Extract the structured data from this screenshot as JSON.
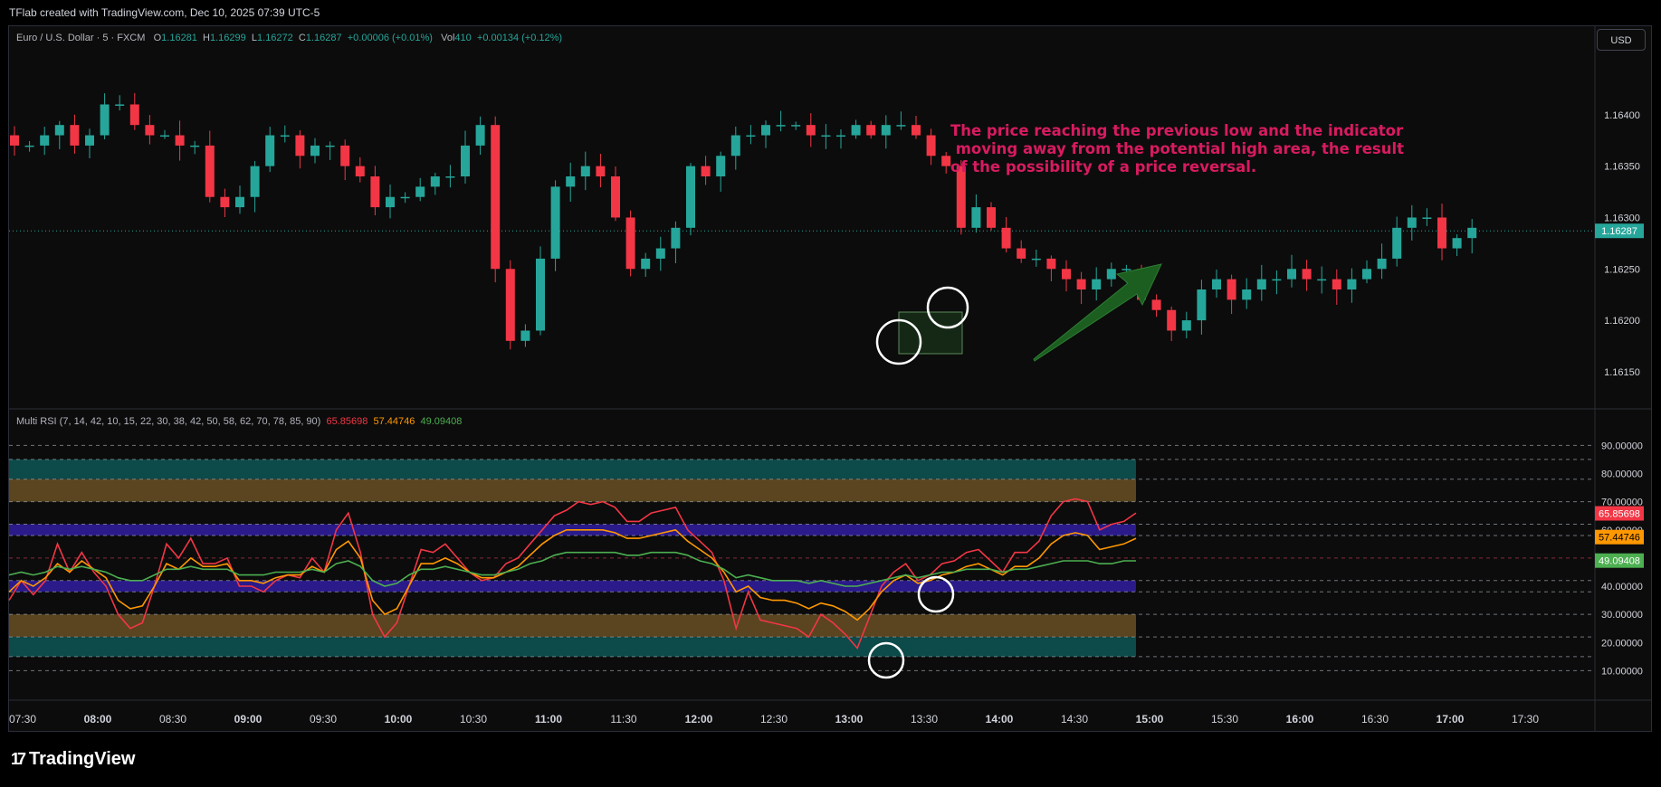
{
  "header": {
    "attribution": "TFlab created with TradingView.com, Dec 10, 2025 07:39 UTC-5"
  },
  "legend": {
    "symbol": "Euro / U.S. Dollar · 5 · FXCM",
    "open_label": "O",
    "open": "1.16281",
    "high_label": "H",
    "high": "1.16299",
    "low_label": "L",
    "low": "1.16272",
    "close_label": "C",
    "close": "1.16287",
    "change": "+0.00006 (+0.01%)",
    "vol_label": "Vol",
    "vol": "410",
    "vol_change": "+0.00134 (+0.12%)"
  },
  "currency_button": "USD",
  "annotation": "The price reaching the previous low and the indicator\n moving away from the potential high area, the result\nof the possibility of a price reversal.",
  "rsi_legend": {
    "name": "Multi RSI (7, 14, 42, 10, 15, 22, 30, 38, 42, 50, 58, 62, 70, 78, 85, 90)",
    "v1": "65.85698",
    "v2": "57.44746",
    "v3": "49.09408"
  },
  "brand": {
    "name": "TradingView"
  },
  "colors": {
    "up": "#26a69a",
    "down": "#f23645",
    "rsi_fast": "#f23645",
    "rsi_mid": "#ff9800",
    "rsi_slow": "#4caf50",
    "annotation": "#d81b60",
    "arrow": "#1b5e20"
  },
  "chart_data": [
    {
      "type": "candlestick",
      "title": "Euro / U.S. Dollar · 5 · FXCM",
      "ylim": [
        1.1612,
        1.1645
      ],
      "yticks": [
        "1.16400",
        "1.16350",
        "1.16300",
        "1.16250",
        "1.16200",
        "1.16150"
      ],
      "last_price": "1.16287",
      "xticks": [
        "07:30",
        "08:00",
        "08:30",
        "09:00",
        "09:30",
        "10:00",
        "10:30",
        "11:00",
        "11:30",
        "12:00",
        "12:30",
        "13:00",
        "13:30",
        "14:00",
        "14:30",
        "15:00",
        "15:30",
        "16:00",
        "16:30",
        "17:00",
        "17:30"
      ],
      "close": [
        1.1637,
        1.1637,
        1.1638,
        1.1639,
        1.1637,
        1.1638,
        1.1641,
        1.1641,
        1.1639,
        1.1638,
        1.1638,
        1.1637,
        1.1637,
        1.1632,
        1.1631,
        1.1632,
        1.1635,
        1.1638,
        1.1638,
        1.1636,
        1.1637,
        1.1637,
        1.1635,
        1.1634,
        1.1631,
        1.1632,
        1.1632,
        1.1633,
        1.1634,
        1.1634,
        1.1637,
        1.1639,
        1.1625,
        1.1618,
        1.1619,
        1.1626,
        1.1633,
        1.1634,
        1.1635,
        1.1634,
        1.163,
        1.1625,
        1.1626,
        1.1627,
        1.1629,
        1.1635,
        1.1634,
        1.1636,
        1.1638,
        1.1638,
        1.1639,
        1.1639,
        1.1639,
        1.1638,
        1.1638,
        1.1638,
        1.1639,
        1.1638,
        1.1639,
        1.1639,
        1.1638,
        1.1636,
        1.1635,
        1.1629,
        1.1631,
        1.1629,
        1.1627,
        1.1626,
        1.1626,
        1.1625,
        1.1624,
        1.1623,
        1.1624,
        1.1625,
        1.1625,
        1.1622,
        1.1621,
        1.1619,
        1.162,
        1.1623,
        1.1624,
        1.1622,
        1.1623,
        1.1624,
        1.1624,
        1.1625,
        1.1624,
        1.1624,
        1.1623,
        1.1624,
        1.1625,
        1.1626,
        1.1629,
        1.163,
        1.163,
        1.1627,
        1.1628,
        1.1629
      ],
      "note": "close prices per 5-minute bar, estimated from the plot"
    },
    {
      "type": "line",
      "title": "Multi RSI (7, 14, 42, 10, 15, 22, 30, 38, 42, 50, 58, 62, 70, 78, 85, 90)",
      "ylim": [
        5,
        93
      ],
      "yticks": [
        "90.00000",
        "80.00000",
        "70.00000",
        "60.00000",
        "50.00000",
        "40.00000",
        "30.00000",
        "20.00000",
        "10.00000"
      ],
      "zones": [
        {
          "from": 78,
          "to": 85,
          "color": "#0d4a4a"
        },
        {
          "from": 70,
          "to": 78,
          "color": "#5a4520"
        },
        {
          "from": 58,
          "to": 62,
          "color": "#2a1a8a"
        },
        {
          "from": 38,
          "to": 42,
          "color": "#2a1a8a"
        },
        {
          "from": 22,
          "to": 30,
          "color": "#5a4520"
        },
        {
          "from": 15,
          "to": 22,
          "color": "#0d4a4a"
        }
      ],
      "levels": [
        90,
        85,
        78,
        70,
        62,
        58,
        50,
        42,
        38,
        30,
        22,
        15,
        10
      ],
      "series": [
        {
          "values": [
            35,
            42,
            37,
            42,
            55,
            45,
            52,
            45,
            40,
            30,
            25,
            27,
            40,
            55,
            50,
            57,
            48,
            48,
            50,
            40,
            40,
            38,
            42,
            44,
            43,
            50,
            45,
            60,
            66,
            52,
            30,
            22,
            27,
            40,
            53,
            52,
            55,
            50,
            45,
            42,
            43,
            48,
            50,
            55,
            60,
            65,
            67,
            70,
            69,
            70,
            68,
            63,
            63,
            66,
            67,
            68,
            60,
            56,
            52,
            42,
            25,
            38,
            28,
            27,
            26,
            25,
            22,
            30,
            27,
            23,
            18,
            29,
            40,
            45,
            48,
            42,
            44,
            48,
            49,
            52,
            53,
            49,
            45,
            52,
            52,
            56,
            65,
            70,
            71,
            70,
            60,
            62,
            63,
            66
          ]
        },
        {
          "values": [
            38,
            42,
            40,
            43,
            48,
            45,
            49,
            46,
            43,
            35,
            32,
            33,
            40,
            48,
            46,
            50,
            47,
            47,
            48,
            42,
            42,
            41,
            43,
            44,
            44,
            47,
            45,
            53,
            56,
            50,
            35,
            30,
            32,
            40,
            48,
            48,
            50,
            48,
            45,
            43,
            43,
            45,
            47,
            51,
            55,
            58,
            60,
            60,
            60,
            60,
            59,
            57,
            57,
            58,
            59,
            60,
            56,
            53,
            50,
            45,
            38,
            40,
            36,
            35,
            35,
            34,
            32,
            34,
            33,
            31,
            28,
            32,
            38,
            42,
            44,
            41,
            42,
            44,
            45,
            47,
            48,
            46,
            44,
            47,
            47,
            50,
            55,
            58,
            59,
            58,
            53,
            54,
            55,
            57
          ]
        },
        {
          "values": [
            44,
            45,
            44,
            45,
            47,
            46,
            47,
            46,
            45,
            43,
            42,
            42,
            44,
            46,
            46,
            47,
            46,
            46,
            46,
            44,
            44,
            44,
            45,
            45,
            45,
            46,
            45,
            48,
            49,
            47,
            42,
            40,
            41,
            44,
            46,
            46,
            47,
            46,
            45,
            44,
            44,
            45,
            46,
            48,
            49,
            51,
            52,
            52,
            52,
            52,
            52,
            51,
            51,
            52,
            52,
            52,
            51,
            49,
            48,
            46,
            43,
            44,
            43,
            42,
            42,
            42,
            41,
            42,
            41,
            40,
            40,
            41,
            42,
            43,
            44,
            43,
            44,
            45,
            45,
            46,
            46,
            46,
            45,
            46,
            46,
            47,
            48,
            49,
            49,
            49,
            48,
            48,
            49,
            49
          ]
        }
      ],
      "last_values": [
        "65.85698",
        "57.44746",
        "49.09408"
      ]
    }
  ]
}
